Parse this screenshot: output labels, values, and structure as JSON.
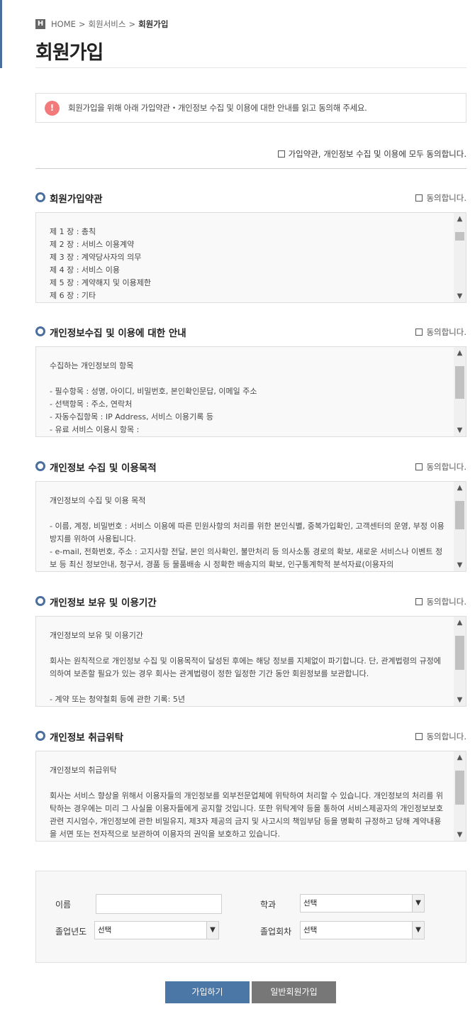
{
  "breadcrumb": {
    "home_icon": "H",
    "home": "HOME",
    "sep1": ">",
    "level1": "회원서비스",
    "sep2": ">",
    "current": "회원가입"
  },
  "page_title": "회원가입",
  "notice": {
    "icon": "!",
    "text": "회원가입을 위해 아래 가입약관・개인정보 수집 및 이용에 대한 안내를 읽고 동의해 주세요."
  },
  "all_agree_label": "가입약관, 개인정보 수집 및 이용에 모두 동의합니다.",
  "sections": [
    {
      "title": "회원가입약관",
      "agree_label": "동의합니다.",
      "lines": [
        "제 1 장 : 총칙",
        "제 2 장 : 서비스 이용계약",
        "제 3 장 : 계약당사자의 의무",
        "제 4 장 : 서비스 이용",
        "제 5 장 : 계약해지 및 이용제한",
        "제 6 장 : 기타"
      ],
      "scroll_position": 0.0
    },
    {
      "title": "개인정보수집 및 이용에 대한 안내",
      "agree_label": "동의합니다.",
      "lines": [
        "수집하는 개인정보의 항목",
        "",
        "- 필수항목 : 성명, 아이디, 비밀번호, 본인확인문답, 이메일 주소",
        "- 선택항목 : 주소, 연락처",
        "- 자동수집항목 : IP Address, 서비스 이용기록 등",
        "- 유료 서비스 이용시 항목 :"
      ],
      "scroll_position": 0.0
    },
    {
      "title": "개인정보 수집 및 이용목적",
      "agree_label": "동의합니다.",
      "lines": [
        "개인정보의 수집 및 이용 목적",
        "",
        "- 이름, 계정, 비밀번호 : 서비스 이용에 따른 민원사항의 처리를 위한 본인식별, 중복가입확인, 고객센터의 운영, 부정 이용 방지를 위하여 사용됩니다.",
        "- e-mail, 전화번호, 주소 : 고지사항 전달, 본인 의사확인, 불만처리 등 의사소통 경로의 확보, 새로운 서비스나 이벤트 정보 등 최신 정보안내, 청구서, 경품 등 물품배송 시 정확한 배송지의 확보, 인구통계학적 분석자료(이용자의"
      ],
      "scroll_position": 0.0
    },
    {
      "title": "개인정보 보유 및 이용기간",
      "agree_label": "동의합니다.",
      "lines": [
        "개인정보의 보유 및 이용기간",
        "",
        "회사는 원칙적으로 개인정보 수집 및 이용목적이 달성된 후에는 해당 정보를 지체없이 파기합니다. 단, 관계법령의 규정에 의하여 보존할 필요가 있는 경우 회사는 관계법령이 정한 일정한 기간 동안 회원정보를 보관합니다.",
        "",
        "- 계약 또는 청약철회 등에 관한 기록: 5년"
      ],
      "scroll_position": 0.0
    },
    {
      "title": "개인정보 취급위탁",
      "agree_label": "동의합니다.",
      "lines": [
        "개인정보의 취급위탁",
        "",
        "회사는 서비스 향상을 위해서 이용자들의 개인정보를 외부전문업체에 위탁하여 처리할 수 있습니다. 개인정보의 처리를 위탁하는 경우에는 미리 그 사실을 이용자들에게 공지할 것입니다. 또한 위탁계약 등을 통하여 서비스제공자의 개인정보보호 관련 지시엄수, 개인정보에 관한 비밀유지, 제3자 제공의 금지 및 사고시의 책임부담 등을 명확히 규정하고 당해 계약내용을 서면 또는 전자적으로 보관하여 이용자의 권익을 보호하고 있습니다."
      ],
      "scroll_position": 0.0
    }
  ],
  "form": {
    "name_label": "이름",
    "name_value": "",
    "dept_label": "학과",
    "dept_selected": "선택",
    "grad_year_label": "졸업년도",
    "grad_year_selected": "선택",
    "grad_term_label": "졸업회차",
    "grad_term_selected": "선택"
  },
  "buttons": {
    "join": "가입하기",
    "general_join": "일반회원가입"
  },
  "colors": {
    "accent": "#4a77a6",
    "notice_icon": "#f27a7a",
    "secondary_button": "#777777"
  },
  "icons": {
    "scroll_up": "▲",
    "scroll_down": "▼",
    "select_arrow": "▼"
  }
}
